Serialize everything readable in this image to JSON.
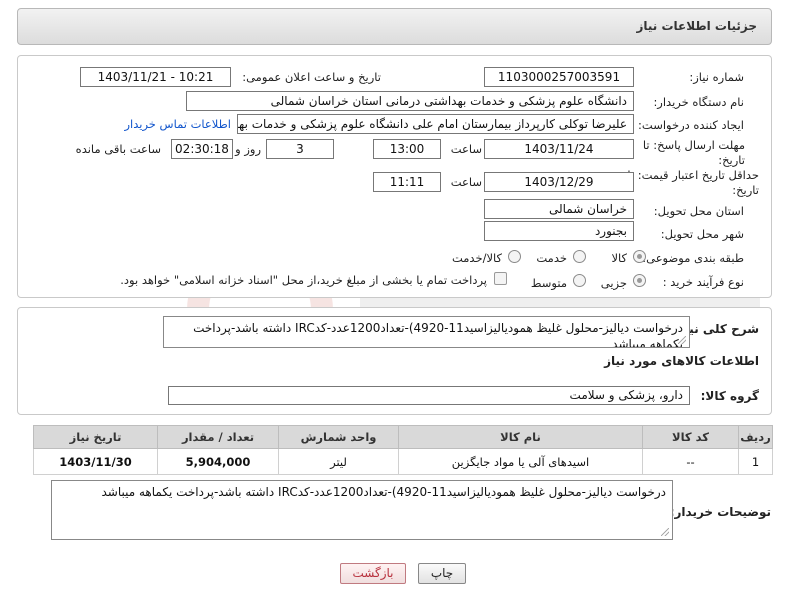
{
  "header": {
    "title": "جزئیات اطلاعات نیاز"
  },
  "form": {
    "need_number_label": "شماره نیاز:",
    "need_number": "1103000257003591",
    "announce_datetime_label": "تاریخ و ساعت اعلان عمومی:",
    "announce_datetime": "1403/11/21 - 10:21",
    "buyer_org_label": "نام دستگاه خریدار:",
    "buyer_org": "دانشگاه علوم پزشکی و خدمات بهداشتی درمانی استان خراسان شمالی",
    "requester_label": "ایجاد کننده درخواست:",
    "requester": "علیرضا توکلی کارپرداز بیمارستان امام علی دانشگاه علوم پزشکی و خدمات بهدا",
    "contact_link": "اطلاعات تماس خریدار",
    "deadline_label": "مهلت ارسال پاسخ: تا تاریخ:",
    "deadline_date": "1403/11/24",
    "time_label": "ساعت",
    "deadline_time": "13:00",
    "days": "3",
    "days_label": "روز و",
    "remaining_time": "02:30:18",
    "remaining_label": "ساعت باقی مانده",
    "validity_label": "حداقل تاریخ اعتبار قیمت: تا تاریخ:",
    "validity_date": "1403/12/29",
    "validity_time_label": "ساعت",
    "validity_time": "11:11",
    "province_label": "استان محل تحویل:",
    "province": "خراسان شمالی",
    "city_label": "شهر محل تحویل:",
    "city": "بجنورد",
    "category_label": "طبقه بندی موضوعی:",
    "category_options": [
      "کالا",
      "خدمت",
      "کالا/خدمت"
    ],
    "process_label": "نوع فرآیند خرید :",
    "process_options": [
      "جزیی",
      "متوسط"
    ],
    "payment_note": "پرداخت تمام یا بخشی از مبلغ خرید،از محل \"اسناد خزانه اسلامی\" خواهد بود."
  },
  "summary": {
    "label": "شرح کلی نیاز:",
    "text": "درخواست دیالیز-محلول غلیظ همودیالیزاسید11-4920)-تعداد1200عدد-کدIRC داشته باشد-پرداخت یکماهه میباشد",
    "goods_info_title": "اطلاعات کالاهای مورد نیاز",
    "goods_group_label": "گروه کالا:",
    "goods_group": "دارو، پزشکی و سلامت"
  },
  "table": {
    "headers": [
      "ردیف",
      "کد کالا",
      "نام کالا",
      "واحد شمارش",
      "تعداد / مقدار",
      "تاریخ نیاز"
    ],
    "rows": [
      {
        "row": "1",
        "code": "--",
        "name": "اسیدهای آلی یا مواد جایگزین",
        "unit": "لیتر",
        "qty": "5,904,000",
        "date": "1403/11/30"
      }
    ]
  },
  "buyer_notes": {
    "label": "توضیحات خریدار:",
    "text": "درخواست دیالیز-محلول غلیظ همودیالیزاسید11-4920)-تعداد1200عدد-کدIRC داشته باشد-پرداخت یکماهه میباشد"
  },
  "buttons": {
    "print": "چاپ",
    "back": "بازگشت"
  },
  "colors": {
    "link": "#1155cc",
    "back_text": "#b8323e",
    "header_bg": "#dcdcdc"
  }
}
